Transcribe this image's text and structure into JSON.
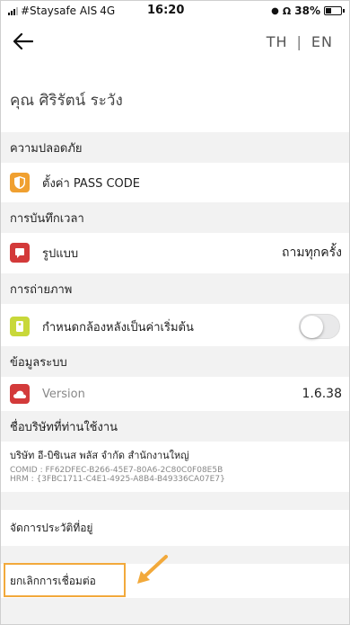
{
  "status_bar": {
    "carrier": "#Staysafe AIS",
    "network": "4G",
    "time": "16:20",
    "battery_text": "38%",
    "battery_level": 0.38
  },
  "nav": {
    "back_icon": "arrow-left-icon",
    "lang_th": "TH",
    "lang_separator": "|",
    "lang_en": "EN"
  },
  "user": {
    "name": "คุณ ศิริรัตน์ ระวัง"
  },
  "sections": {
    "security": {
      "header": "ความปลอดภัย",
      "passcode_label": "ตั้งค่า PASS CODE",
      "icon_color": "#f0a030"
    },
    "time_record": {
      "header": "การบันทึกเวลา",
      "mode_label": "รูปแบบ",
      "mode_value": "ถามทุกครั้ง",
      "icon_color": "#d33a3a"
    },
    "photo": {
      "header": "การถ่ายภาพ",
      "rear_camera_label": "กำหนดกล้องหลังเป็นค่าเริ่มต้น",
      "rear_camera_enabled": false,
      "icon_color": "#c8d83a"
    },
    "system": {
      "header": "ข้อมูลระบบ",
      "version_label": "Version",
      "version_value": "1.6.38",
      "icon_color": "#d33a3a"
    },
    "company": {
      "header": "ชื่อบริษัทที่ท่านใช้งาน",
      "name": "บริษัท อี-บิซิเนส พลัส จำกัด สำนักงานใหญ่",
      "comid": "COMID : FF62DFEC-B266-45E7-80A6-2C80C0F08E5B",
      "hrm": "HRM : {3FBC1711-C4E1-4925-A8B4-B49336CA07E7}"
    }
  },
  "actions": {
    "manage_address": "จัดการประวัติที่อยู่",
    "disconnect": "ยกเลิกการเชื่อมต่อ"
  },
  "colors": {
    "highlight": "#f2a93b",
    "section_bg": "#f2f2f2"
  }
}
